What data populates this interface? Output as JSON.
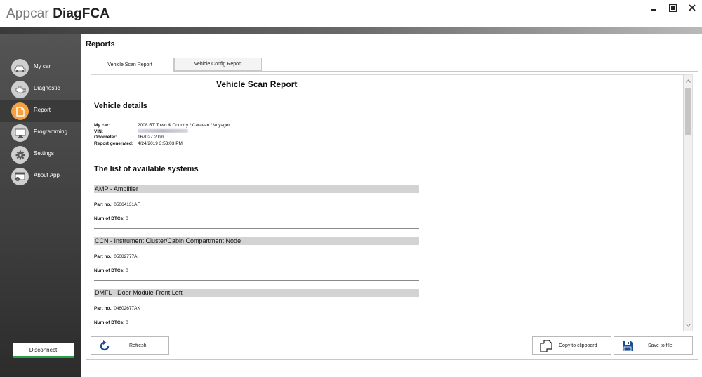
{
  "app": {
    "brand": "Appcar ",
    "product": "DiagFCA"
  },
  "window": {
    "minimize": "_",
    "maximize": "⧉",
    "close": "×"
  },
  "sidebar": {
    "items": [
      {
        "label": "My car",
        "icon": "car-icon",
        "active": false
      },
      {
        "label": "Diagnostic",
        "icon": "engine-icon",
        "active": false
      },
      {
        "label": "Report",
        "icon": "document-icon",
        "active": true
      },
      {
        "label": "Programming",
        "icon": "monitor-icon",
        "active": false
      },
      {
        "label": "Settings",
        "icon": "gear-icon",
        "active": false
      },
      {
        "label": "About App",
        "icon": "about-window-icon",
        "active": false
      }
    ],
    "disconnect_label": "Disconnect"
  },
  "main": {
    "title": "Reports",
    "tabs": [
      {
        "label": "Vehicle Scan Report",
        "active": true
      },
      {
        "label": "Vehicle Config Report",
        "active": false
      }
    ]
  },
  "report": {
    "title": "Vehicle Scan Report",
    "vehicle_details_heading": "Vehicle details",
    "details": {
      "my_car_label": "My car:",
      "my_car_value": "2008 RT Town & Country / Caravan / Voyager",
      "vin_label": "VIN:",
      "odometer_label": "Odometer:",
      "odometer_value": "167027.2 km",
      "generated_label": "Report generated:",
      "generated_value": "4/24/2019 3:53:03 PM"
    },
    "systems_heading": "The list of available systems",
    "systems": [
      {
        "name": "AMP - Amplifier",
        "part_label": "Part no.:",
        "part_no": "05064131AF",
        "dtc_label": "Num of DTCs:",
        "dtc_count": "0"
      },
      {
        "name": "CCN - Instrument Cluster/Cabin Compartment Node",
        "part_label": "Part no.:",
        "part_no": "05082777AH",
        "dtc_label": "Num of DTCs:",
        "dtc_count": "0"
      },
      {
        "name": "DMFL - Door Module Front Left",
        "part_label": "Part no.:",
        "part_no": "04602677AK",
        "dtc_label": "Num of DTCs:",
        "dtc_count": "0"
      }
    ]
  },
  "buttons": {
    "refresh": "Refresh",
    "copy": "Copy to clipboard",
    "save": "Save to file"
  },
  "colors": {
    "accent": "#f5a142",
    "connected": "#2aa148"
  }
}
